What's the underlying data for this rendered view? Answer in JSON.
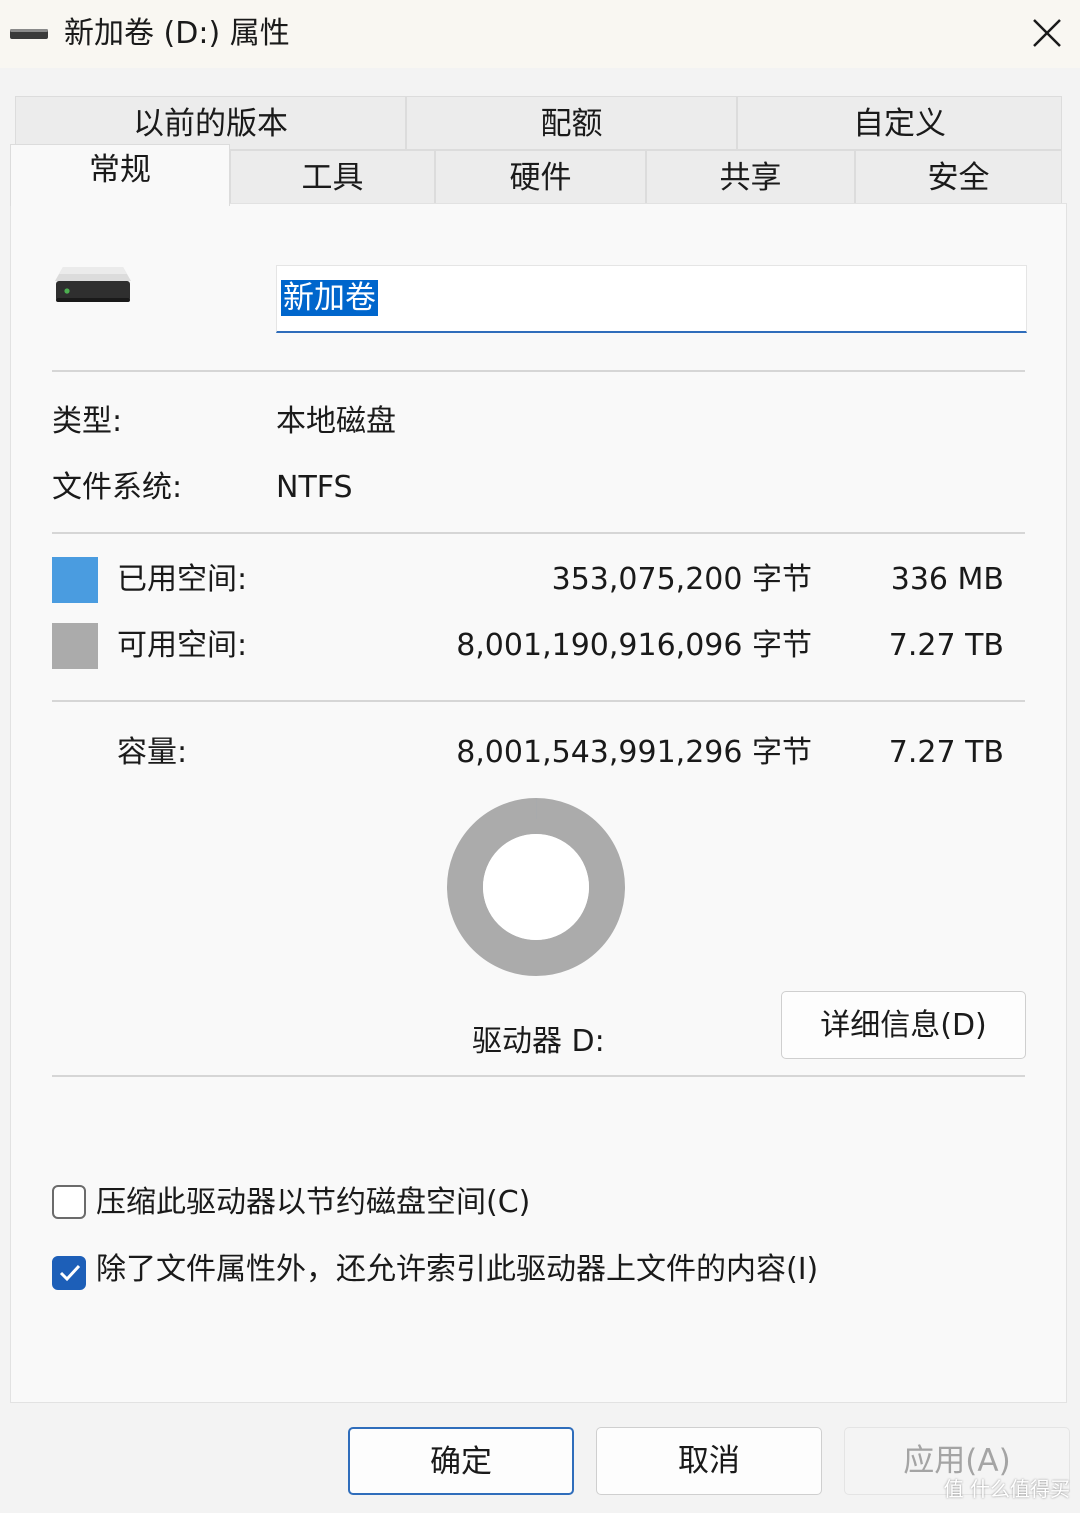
{
  "window": {
    "title": "新加卷 (D:) 属性",
    "icon": "drive-icon",
    "close_icon": "close-icon"
  },
  "tabs": {
    "back_row": [
      "以前的版本",
      "配额",
      "自定义"
    ],
    "front_row": [
      "常规",
      "工具",
      "硬件",
      "共享",
      "安全"
    ],
    "active": "常规"
  },
  "general": {
    "volume_name": "新加卷",
    "type_label": "类型:",
    "type_value": "本地磁盘",
    "fs_label": "文件系统:",
    "fs_value": "NTFS",
    "used_label": "已用空间:",
    "used_bytes": "353,075,200 字节",
    "used_size": "336 MB",
    "free_label": "可用空间:",
    "free_bytes": "8,001,190,916,096 字节",
    "free_size": "7.27 TB",
    "capacity_label": "容量:",
    "capacity_bytes": "8,001,543,991,296 字节",
    "capacity_size": "7.27 TB",
    "drive_label": "驱动器 D:",
    "details_button": "详细信息(D)",
    "used_fraction": 4.4e-05,
    "colors": {
      "used": "#4a9ce0",
      "free": "#ababab",
      "accent": "#2f6dbb",
      "check": "#1d5fb8"
    }
  },
  "options": {
    "compress_label": "压缩此驱动器以节约磁盘空间(C)",
    "compress_checked": false,
    "index_label": "除了文件属性外，还允许索引此驱动器上文件的内容(I)",
    "index_checked": true
  },
  "footer": {
    "ok": "确定",
    "cancel": "取消",
    "apply": "应用(A)"
  },
  "watermark": "值 什么值得买"
}
